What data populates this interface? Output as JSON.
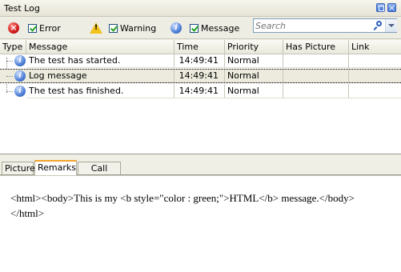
{
  "window": {
    "title": "Test Log"
  },
  "toolbar": {
    "error_label": "Error",
    "warning_label": "Warning",
    "message_label": "Message",
    "error_checked": true,
    "warning_checked": true,
    "message_checked": true
  },
  "search": {
    "placeholder": "Search"
  },
  "grid": {
    "columns": [
      "Type",
      "Message",
      "Time",
      "Priority",
      "Has Picture",
      "Link"
    ],
    "rows": [
      {
        "type_icon": "info-icon",
        "message": "The test has started.",
        "time": "14:49:41",
        "priority": "Normal",
        "has_picture": "",
        "link": ""
      },
      {
        "type_icon": "info-icon",
        "message": "Log message",
        "time": "14:49:41",
        "priority": "Normal",
        "has_picture": "",
        "link": "",
        "selected": true
      },
      {
        "type_icon": "info-icon",
        "message": "The test has finished.",
        "time": "14:49:41",
        "priority": "Normal",
        "has_picture": "",
        "link": ""
      }
    ]
  },
  "tabs": [
    {
      "label": "Picture"
    },
    {
      "label": "Remarks",
      "active": true
    },
    {
      "label": "Call Stack"
    }
  ],
  "remarks": {
    "text": "<html><body>This is my <b style=\"color : green;\">HTML</b> message.</body></html>"
  },
  "colors": {
    "active_tab_accent": "#f3a42c",
    "selected_row": "#ecebdd"
  }
}
